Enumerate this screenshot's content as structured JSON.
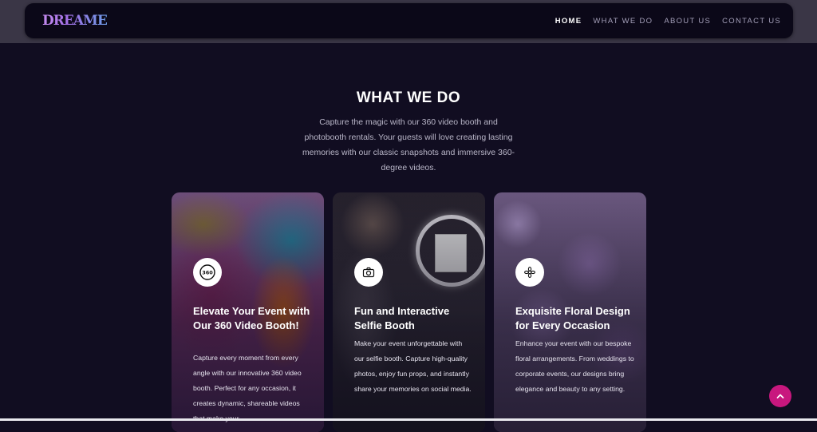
{
  "nav": {
    "logo": "DREAME",
    "links": [
      {
        "label": "HOME",
        "active": true
      },
      {
        "label": "WHAT WE DO",
        "active": false
      },
      {
        "label": "ABOUT US",
        "active": false
      },
      {
        "label": "CONTACT US",
        "active": false
      }
    ]
  },
  "section": {
    "title": "WHAT WE DO",
    "description": "Capture the magic with our 360 video booth and photobooth rentals. Your guests will love creating lasting memories with our classic snapshots and immersive 360-degree videos."
  },
  "cards": [
    {
      "icon": "360-icon",
      "icon_text": "360",
      "title": "Elevate Your Event with Our 360 Video Booth!",
      "text": "Capture every moment from every angle with our innovative 360 video booth. Perfect for any occasion, it creates dynamic, shareable videos that make your"
    },
    {
      "icon": "camera-icon",
      "title": "Fun and Interactive Selfie Booth",
      "text": "Make your event unforgettable with our selfie booth. Capture high-quality photos, enjoy fun props, and instantly share your memories on social media."
    },
    {
      "icon": "flower-icon",
      "title": "Exquisite Floral Design for Every Occasion",
      "text": "Enhance your event with our bespoke floral arrangements. From weddings to corporate events, our designs bring elegance and beauty to any setting."
    }
  ],
  "scroll_top": {
    "icon": "chevron-up-icon"
  },
  "colors": {
    "background": "#110d21",
    "accent": "#c8177e"
  }
}
